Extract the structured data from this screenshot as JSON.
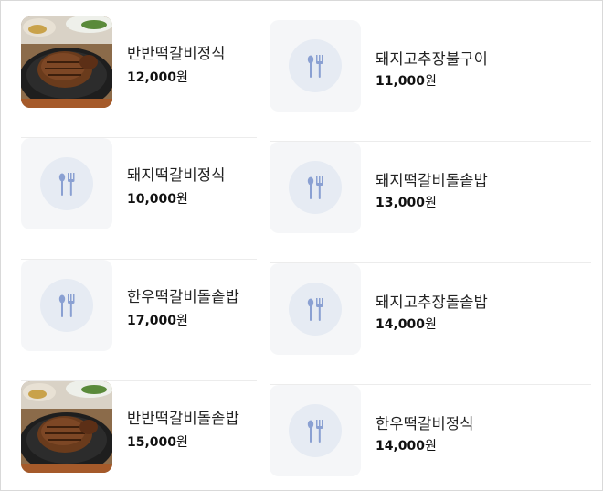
{
  "menu": {
    "left": [
      {
        "name": "반반떡갈비정식",
        "price": "12,000",
        "unit": "원",
        "thumb": "photo"
      },
      {
        "name": "돼지떡갈비정식",
        "price": "10,000",
        "unit": "원",
        "thumb": "placeholder"
      },
      {
        "name": "한우떡갈비돌솥밥",
        "price": "17,000",
        "unit": "원",
        "thumb": "placeholder"
      },
      {
        "name": "반반떡갈비돌솥밥",
        "price": "15,000",
        "unit": "원",
        "thumb": "photo"
      }
    ],
    "right": [
      {
        "name": "돼지고추장불구이",
        "price": "11,000",
        "unit": "원",
        "thumb": "placeholder"
      },
      {
        "name": "돼지떡갈비돌솥밥",
        "price": "13,000",
        "unit": "원",
        "thumb": "placeholder"
      },
      {
        "name": "돼지고추장돌솥밥",
        "price": "14,000",
        "unit": "원",
        "thumb": "placeholder"
      },
      {
        "name": "한우떡갈비정식",
        "price": "14,000",
        "unit": "원",
        "thumb": "placeholder"
      }
    ]
  },
  "icons": {
    "placeholder": "fork-spoon-icon",
    "photo": "food-photo"
  },
  "colors": {
    "placeholder_bg": "#f5f6f8",
    "placeholder_circle": "#e6ebf3",
    "icon": "#8aa0d2"
  }
}
